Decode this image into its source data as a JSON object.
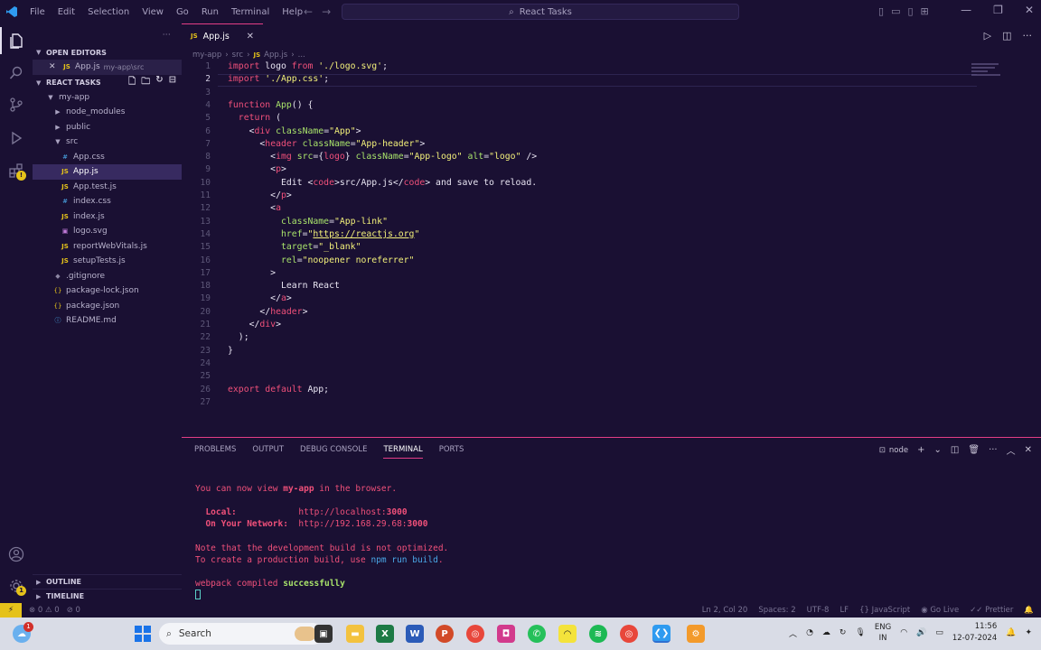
{
  "titlebar": {
    "menus": [
      "File",
      "Edit",
      "Selection",
      "View",
      "Go",
      "Run",
      "Terminal",
      "Help"
    ],
    "search_text": "React Tasks"
  },
  "sidebar": {
    "open_editors_title": "OPEN EDITORS",
    "open_editor": {
      "name": "App.js",
      "path": "my-app\\src"
    },
    "workspace_title": "REACT TASKS",
    "tree": [
      {
        "label": "my-app",
        "kind": "folder-open"
      },
      {
        "label": "node_modules",
        "kind": "folder"
      },
      {
        "label": "public",
        "kind": "folder"
      },
      {
        "label": "src",
        "kind": "folder-open"
      },
      {
        "label": "App.css",
        "kind": "css"
      },
      {
        "label": "App.js",
        "kind": "js"
      },
      {
        "label": "App.test.js",
        "kind": "js"
      },
      {
        "label": "index.css",
        "kind": "css"
      },
      {
        "label": "index.js",
        "kind": "js"
      },
      {
        "label": "logo.svg",
        "kind": "svg"
      },
      {
        "label": "reportWebVitals.js",
        "kind": "js"
      },
      {
        "label": "setupTests.js",
        "kind": "js"
      },
      {
        "label": ".gitignore",
        "kind": "git"
      },
      {
        "label": "package-lock.json",
        "kind": "json"
      },
      {
        "label": "package.json",
        "kind": "json"
      },
      {
        "label": "README.md",
        "kind": "info"
      }
    ],
    "outline_title": "OUTLINE",
    "timeline_title": "TIMELINE"
  },
  "editor": {
    "tab_label": "App.js",
    "breadcrumb": [
      "my-app",
      "src",
      "App.js",
      "..."
    ],
    "line_numbers": [
      "1",
      "2",
      "3",
      "4",
      "5",
      "6",
      "7",
      "8",
      "9",
      "10",
      "11",
      "12",
      "13",
      "14",
      "15",
      "16",
      "17",
      "18",
      "19",
      "20",
      "21",
      "22",
      "23",
      "24",
      "25",
      "26",
      "27"
    ],
    "current_line": "2"
  },
  "panel": {
    "tabs": [
      "PROBLEMS",
      "OUTPUT",
      "DEBUG CONSOLE",
      "TERMINAL",
      "PORTS"
    ],
    "active_tab": "TERMINAL",
    "shell": "node",
    "term1_pre": "You can now view ",
    "term1_app": "my-app",
    "term1_post": " in the browser.",
    "local_label": "Local:",
    "local_url_base": "http://localhost:",
    "local_port": "3000",
    "network_label": "On Your Network:",
    "network_url_base": "http://192.168.29.68:",
    "network_port": "3000",
    "note1": "Note that the development build is not optimized.",
    "note2_pre": "To create a production build, use ",
    "note2_cmd": "npm run build",
    "note2_post": ".",
    "compiled_pre": "webpack compiled ",
    "compiled_status": "successfully"
  },
  "status": {
    "errors": "0",
    "warnings": "0",
    "ports": "0",
    "position": "Ln 2, Col 20",
    "spaces": "Spaces: 2",
    "encoding": "UTF-8",
    "eol": "LF",
    "language": "JavaScript",
    "golive": "Go Live",
    "prettier": "Prettier"
  },
  "taskbar": {
    "search_placeholder": "Search",
    "notification_count": "1",
    "lang_top": "ENG",
    "lang_bottom": "IN",
    "time": "11:56",
    "date": "12-07-2024"
  }
}
